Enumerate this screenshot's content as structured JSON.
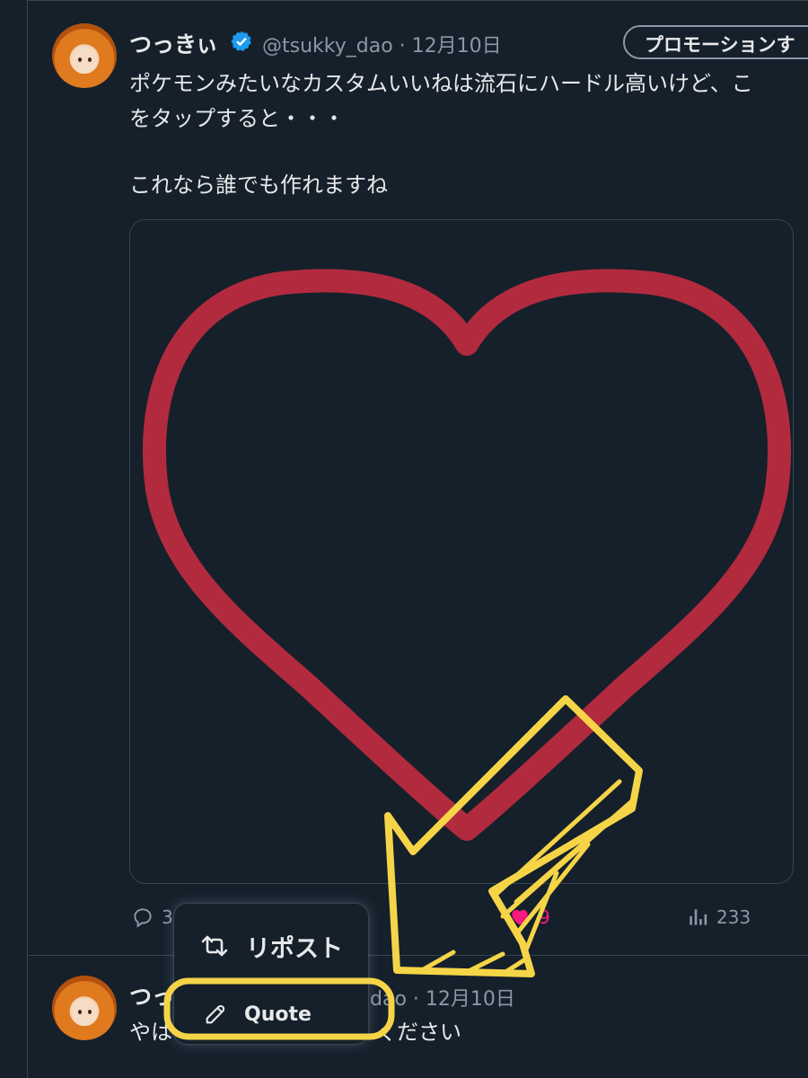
{
  "tweet": {
    "name": "つっきぃ",
    "handle": "@tsukky_dao",
    "date": "12月10日",
    "promo_label": "プロモーションす",
    "text_line1": "ポケモンみたいなカスタムいいねは流石にハードル高いけど、こ",
    "text_line2": "をタップすると・・・",
    "text_line3": "これなら誰でも作れますね",
    "actions": {
      "reply_count": "3",
      "like_count": "9",
      "views_count": "233"
    }
  },
  "menu": {
    "repost_label": "リポスト",
    "quote_label": "Quote"
  },
  "reply": {
    "name": "つっ",
    "handle_date": "dao · 12月10日",
    "text_start": "やは",
    "text_end": "ください"
  },
  "colors": {
    "background": "#15202b",
    "heart": "#b22a3e",
    "annotation": "#f5d547",
    "verified": "#1d9bf0",
    "like_accent": "#f91880"
  },
  "icons": {
    "verified": "verified-badge-icon",
    "reply": "reply-icon",
    "like": "heart-icon",
    "views": "views-icon",
    "repost": "repost-icon",
    "quote": "pencil-icon"
  }
}
